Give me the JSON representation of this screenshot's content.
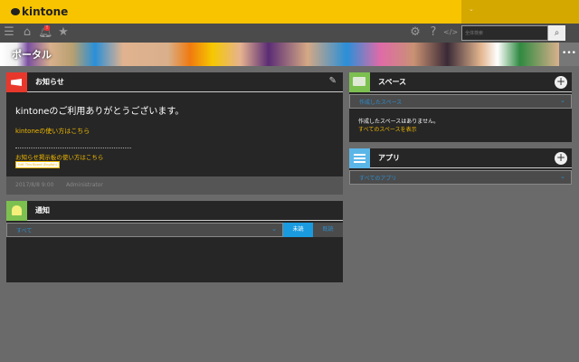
{
  "header": {
    "logo": "kintone",
    "dropdown_icon": "chevron-down-icon"
  },
  "toolbar": {
    "search_placeholder": "全体検索",
    "notification_badge": "!"
  },
  "banner": {
    "title": "ポータル",
    "more": "•••"
  },
  "notice": {
    "title": "お知らせ",
    "heading": "kintoneのご利用ありがとうございます。",
    "link1": "kintoneの使い方はこちら",
    "link2": "お知らせ掲示板の使い方はこちら",
    "edit_board": "Edit This Board (English)",
    "date": "2017/8/8 9:00",
    "author": "Administrator"
  },
  "notifications": {
    "title": "通知",
    "filter": "すべて",
    "tab_unread": "未読",
    "tab_read": "既読"
  },
  "space": {
    "title": "スペース",
    "filter": "作成したスペース",
    "empty": "作成したスペースはありません。",
    "show_all": "すべてのスペースを表示"
  },
  "apps": {
    "title": "アプリ",
    "filter": "すべてのアプリ"
  },
  "colors": {
    "brand": "#f8c400",
    "accent": "#1a9be0"
  }
}
